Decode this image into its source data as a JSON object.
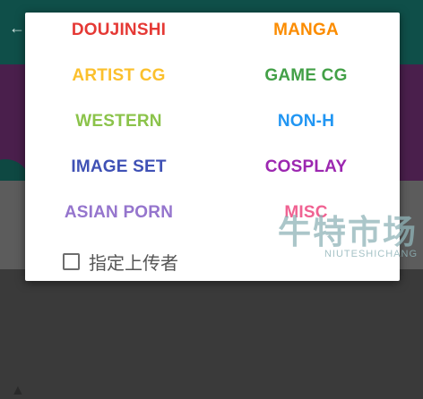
{
  "background": {
    "back_icon": "←"
  },
  "dialog": {
    "categories": [
      {
        "label": "DOUJINSHI",
        "color": "#e53935"
      },
      {
        "label": "MANGA",
        "color": "#fb8c00"
      },
      {
        "label": "ARTIST CG",
        "color": "#fbc02d"
      },
      {
        "label": "GAME CG",
        "color": "#43a047"
      },
      {
        "label": "WESTERN",
        "color": "#8bc34a"
      },
      {
        "label": "NON-H",
        "color": "#2196f3"
      },
      {
        "label": "IMAGE SET",
        "color": "#3f51b5"
      },
      {
        "label": "COSPLAY",
        "color": "#9c27b0"
      },
      {
        "label": "ASIAN PORN",
        "color": "#9575cd"
      },
      {
        "label": "MISC",
        "color": "#f06292"
      }
    ],
    "uploader_checkbox": {
      "label": "指定上传者",
      "checked": false
    }
  },
  "watermark": {
    "cn": "牛特市场",
    "en": "NIUTESHICHANG"
  }
}
